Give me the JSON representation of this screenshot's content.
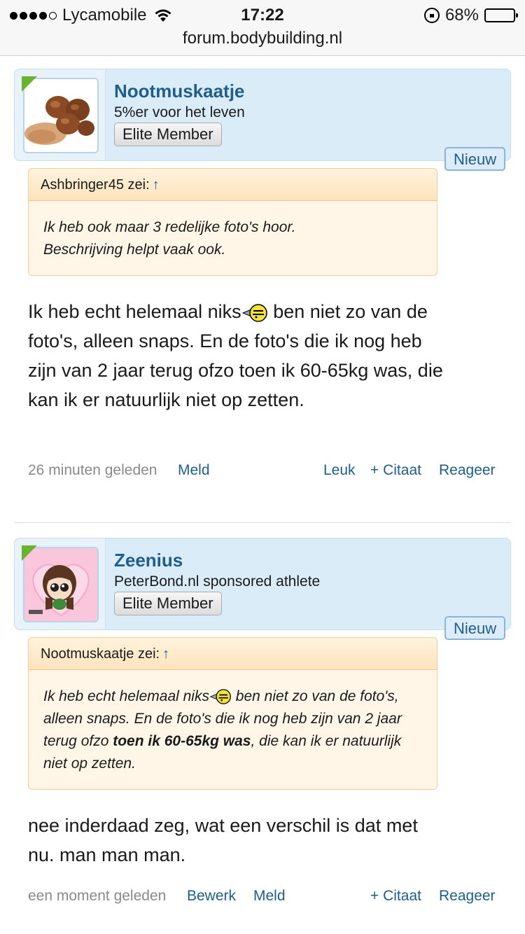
{
  "status_bar": {
    "carrier": "Lycamobile",
    "time": "17:22",
    "battery_percent": "68%",
    "battery_level": 0.68
  },
  "url_bar": {
    "domain": "forum.bodybuilding.nl"
  },
  "posts": [
    {
      "username": "Nootmuskaatje",
      "user_title": "5%er voor het leven",
      "rank": "Elite Member",
      "new_badge": "Nieuw",
      "quote": {
        "header": "Ashbringer45 zei:",
        "arrow": "↑",
        "line1": "Ik heb ook maar 3 redelijke foto's hoor.",
        "line2": "Beschrijving helpt vaak ook."
      },
      "text": {
        "part1": "Ik heb echt helemaal niks",
        "part2": " ben niet zo van de foto's, alleen snaps. En de foto's die ik nog heb zijn van 2 jaar terug ofzo toen ik 60-65kg was, die kan ik er natuurlijk niet op zetten."
      },
      "footer": {
        "time": "26 minuten geleden",
        "meld": "Meld",
        "leuk": "Leuk",
        "citaat": "+ Citaat",
        "reageer": "Reageer"
      }
    },
    {
      "username": "Zeenius",
      "user_title": "PeterBond.nl sponsored athlete",
      "rank": "Elite Member",
      "new_badge": "Nieuw",
      "quote": {
        "header": "Nootmuskaatje zei:",
        "arrow": "↑",
        "part1": "Ik heb echt helemaal niks",
        "part2": " ben niet zo van de foto's, alleen snaps. En de foto's die ik nog heb zijn van 2 jaar terug ofzo ",
        "bold": "toen ik 60-65kg was",
        "part3": ", die kan ik er natuurlijk niet op zetten."
      },
      "text": "nee inderdaad zeg, wat een verschil is dat met nu. man man man.",
      "footer": {
        "time": "een moment geleden",
        "bewerk": "Bewerk",
        "meld": "Meld",
        "citaat": "+ Citaat",
        "reageer": "Reageer"
      }
    }
  ]
}
